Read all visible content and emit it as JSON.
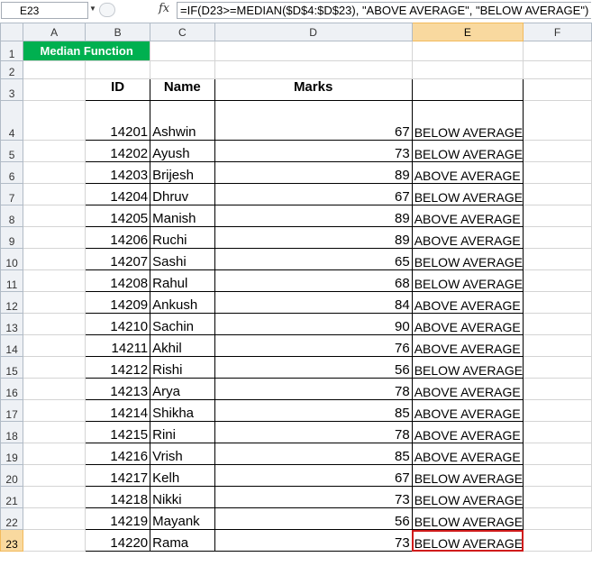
{
  "formula_bar": {
    "name_box": "E23",
    "fx_label": "fx",
    "formula": "=IF(D23>=MEDIAN($D$4:$D$23), \"ABOVE AVERAGE\", \"BELOW AVERAGE\")"
  },
  "columns": [
    "A",
    "B",
    "C",
    "D",
    "E",
    "F"
  ],
  "sheet": {
    "title": "Median Function",
    "headers": {
      "id": "ID",
      "name": "Name",
      "marks": "Marks",
      "result": ""
    },
    "rows": [
      {
        "id": "14201",
        "name": "Ashwin",
        "marks": "67",
        "result": "BELOW AVERAGE"
      },
      {
        "id": "14202",
        "name": "Ayush",
        "marks": "73",
        "result": "BELOW AVERAGE"
      },
      {
        "id": "14203",
        "name": "Brijesh",
        "marks": "89",
        "result": "ABOVE AVERAGE"
      },
      {
        "id": "14204",
        "name": "Dhruv",
        "marks": "67",
        "result": "BELOW AVERAGE"
      },
      {
        "id": "14205",
        "name": "Manish",
        "marks": "89",
        "result": "ABOVE AVERAGE"
      },
      {
        "id": "14206",
        "name": "Ruchi",
        "marks": "89",
        "result": "ABOVE AVERAGE"
      },
      {
        "id": "14207",
        "name": "Sashi",
        "marks": "65",
        "result": "BELOW AVERAGE"
      },
      {
        "id": "14208",
        "name": "Rahul",
        "marks": "68",
        "result": "BELOW AVERAGE"
      },
      {
        "id": "14209",
        "name": "Ankush",
        "marks": "84",
        "result": "ABOVE AVERAGE"
      },
      {
        "id": "14210",
        "name": "Sachin",
        "marks": "90",
        "result": "ABOVE AVERAGE"
      },
      {
        "id": "14211",
        "name": "Akhil",
        "marks": "76",
        "result": "ABOVE AVERAGE"
      },
      {
        "id": "14212",
        "name": "Rishi",
        "marks": "56",
        "result": "BELOW AVERAGE"
      },
      {
        "id": "14213",
        "name": "Arya",
        "marks": "78",
        "result": "ABOVE AVERAGE"
      },
      {
        "id": "14214",
        "name": "Shikha",
        "marks": "85",
        "result": "ABOVE AVERAGE"
      },
      {
        "id": "14215",
        "name": "Rini",
        "marks": "78",
        "result": "ABOVE AVERAGE"
      },
      {
        "id": "14216",
        "name": "Vrish",
        "marks": "85",
        "result": "ABOVE AVERAGE"
      },
      {
        "id": "14217",
        "name": "Kelh",
        "marks": "67",
        "result": "BELOW AVERAGE"
      },
      {
        "id": "14218",
        "name": "Nikki",
        "marks": "73",
        "result": "BELOW AVERAGE"
      },
      {
        "id": "14219",
        "name": "Mayank",
        "marks": "56",
        "result": "BELOW AVERAGE"
      },
      {
        "id": "14220",
        "name": "Rama",
        "marks": "73",
        "result": "BELOW AVERAGE"
      }
    ]
  },
  "selected_cell": "E23",
  "colors": {
    "title_fill": "#00b050",
    "selection": "#d01c1c",
    "active_header": "#f9d99f"
  }
}
